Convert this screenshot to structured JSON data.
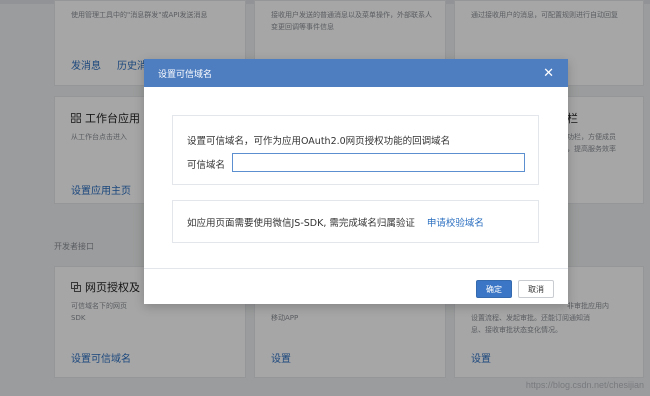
{
  "background": {
    "card1": {
      "desc": "使用管理工具中的\"消息群发\"或API发送消息",
      "link1": "发消息",
      "link2": "历史消"
    },
    "card2": {
      "desc": "接收用户发送的普通消息以及菜单操作，外部联系人变更回调等事件信息"
    },
    "card3": {
      "desc": "通过接收用户的消息，可配置规则进行自动回复"
    },
    "card4": {
      "title": "工作台应用",
      "desc": "从工作台点击进入",
      "link": "设置应用主页"
    },
    "card6": {
      "title_tail": "栏",
      "desc1": "功栏，方便成员",
      "desc2": "，提高服务效率"
    },
    "section_label": "开发者接口",
    "card7": {
      "title": "网页授权及",
      "desc1": "可信域名下的网页",
      "desc2": "SDK",
      "link": "设置可信域名"
    },
    "card8": {
      "desc": "移动APP",
      "link": "设置"
    },
    "card9": {
      "desc1": "非审批应用内",
      "desc2": "设置流程、发起审批。还能订阅通知消",
      "desc3": "息、接收审批状态变化情况。",
      "link": "设置"
    },
    "watermark": "https://blog.csdn.net/chesijian"
  },
  "modal": {
    "title": "设置可信域名",
    "close_symbol": "✕",
    "description": "设置可信域名，可作为应用OAuth2.0网页授权功能的回调域名",
    "field_label": "可信域名",
    "field_value": "",
    "field_placeholder": "",
    "jssdk_text": "如应用页面需要使用微信JS-SDK, 需完成域名归属验证",
    "jssdk_link": "申请校验域名",
    "confirm_label": "确定",
    "cancel_label": "取消"
  }
}
